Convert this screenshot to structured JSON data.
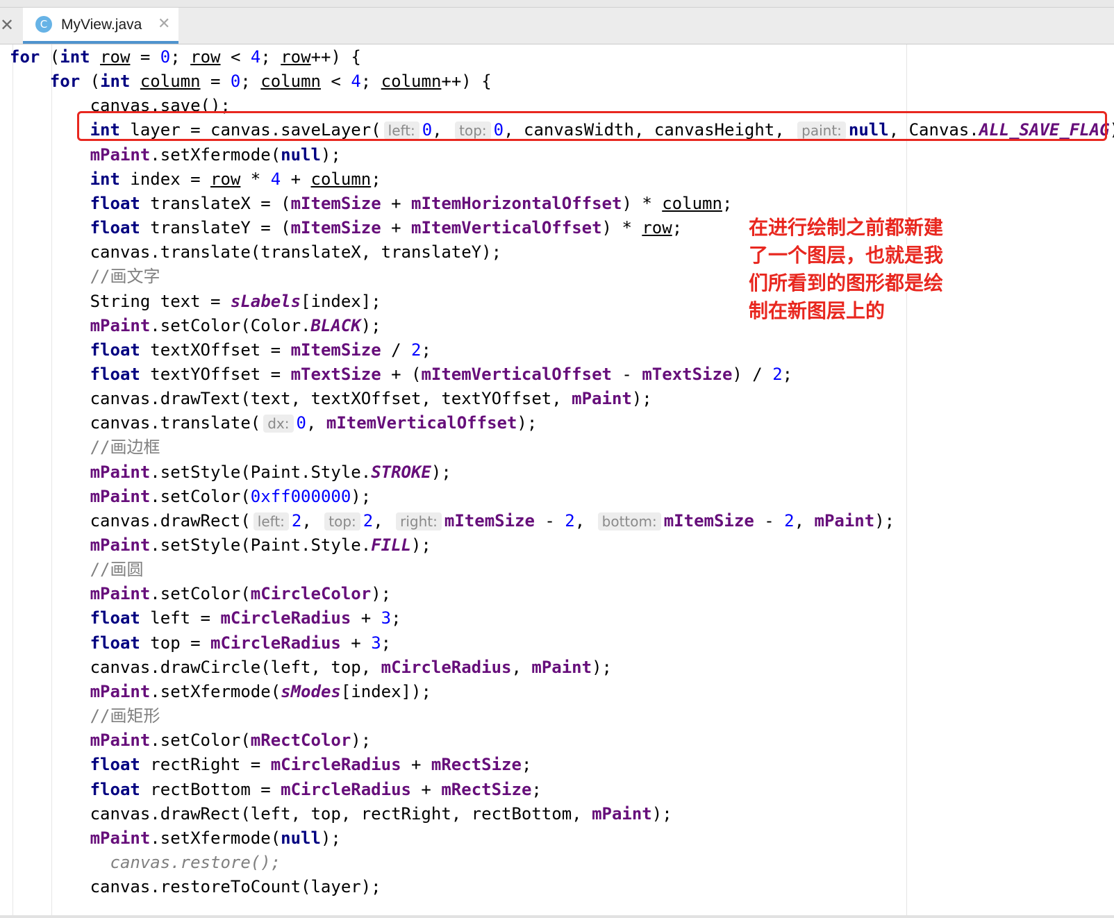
{
  "editor_tab": {
    "icon_letter": "C",
    "filename": "MyView.java",
    "close_glyph": "✕"
  },
  "left_close_glyph": "✕",
  "annotation": [
    "在进行绘制之前都新建",
    "了一个图层，也就是我",
    "们所看到的图形都是绘",
    "制在新图层上的"
  ],
  "code_lines": [
    [
      [
        "kw",
        "for"
      ],
      [
        "t",
        " ("
      ],
      [
        "kw",
        "int "
      ],
      [
        "u",
        "row"
      ],
      [
        "t",
        " = "
      ],
      [
        "n",
        "0"
      ],
      [
        "t",
        "; "
      ],
      [
        "u",
        "row"
      ],
      [
        "t",
        " < "
      ],
      [
        "n",
        "4"
      ],
      [
        "t",
        "; "
      ],
      [
        "u",
        "row"
      ],
      [
        "t",
        "++) {"
      ]
    ],
    [
      [
        "t",
        "    "
      ],
      [
        "kw",
        "for"
      ],
      [
        "t",
        " ("
      ],
      [
        "kw",
        "int "
      ],
      [
        "u",
        "column"
      ],
      [
        "t",
        " = "
      ],
      [
        "n",
        "0"
      ],
      [
        "t",
        "; "
      ],
      [
        "u",
        "column"
      ],
      [
        "t",
        " < "
      ],
      [
        "n",
        "4"
      ],
      [
        "t",
        "; "
      ],
      [
        "u",
        "column"
      ],
      [
        "t",
        "++) {"
      ]
    ],
    [
      [
        "t",
        "        canvas.save();"
      ]
    ],
    [
      [
        "t",
        "        "
      ],
      [
        "kw",
        "int"
      ],
      [
        "t",
        " layer = canvas.saveLayer("
      ],
      [
        "h",
        "left:"
      ],
      [
        "n",
        "0"
      ],
      [
        "t",
        ", "
      ],
      [
        "h",
        "top:"
      ],
      [
        "n",
        "0"
      ],
      [
        "t",
        ", canvasWidth, canvasHeight, "
      ],
      [
        "h",
        "paint:"
      ],
      [
        "kw",
        "null"
      ],
      [
        "t",
        ", Canvas."
      ],
      [
        "s",
        "ALL_SAVE_FLAG"
      ],
      [
        "t",
        ");"
      ]
    ],
    [
      [
        "t",
        "        "
      ],
      [
        "f",
        "mPaint"
      ],
      [
        "t",
        ".setXfermode("
      ],
      [
        "kw",
        "null"
      ],
      [
        "t",
        ");"
      ]
    ],
    [
      [
        "t",
        "        "
      ],
      [
        "kw",
        "int"
      ],
      [
        "t",
        " index = "
      ],
      [
        "u",
        "row"
      ],
      [
        "t",
        " * "
      ],
      [
        "n",
        "4"
      ],
      [
        "t",
        " + "
      ],
      [
        "u",
        "column"
      ],
      [
        "t",
        ";"
      ]
    ],
    [
      [
        "t",
        "        "
      ],
      [
        "kw",
        "float"
      ],
      [
        "t",
        " translateX = ("
      ],
      [
        "f",
        "mItemSize"
      ],
      [
        "t",
        " + "
      ],
      [
        "f",
        "mItemHorizontalOffset"
      ],
      [
        "t",
        ") * "
      ],
      [
        "u",
        "column"
      ],
      [
        "t",
        ";"
      ]
    ],
    [
      [
        "t",
        "        "
      ],
      [
        "kw",
        "float"
      ],
      [
        "t",
        " translateY = ("
      ],
      [
        "f",
        "mItemSize"
      ],
      [
        "t",
        " + "
      ],
      [
        "f",
        "mItemVerticalOffset"
      ],
      [
        "t",
        ") * "
      ],
      [
        "u",
        "row"
      ],
      [
        "t",
        ";"
      ]
    ],
    [
      [
        "t",
        "        canvas.translate(translateX, translateY);"
      ]
    ],
    [
      [
        "t",
        "        "
      ],
      [
        "c",
        "//画文字"
      ]
    ],
    [
      [
        "t",
        "        String text = "
      ],
      [
        "s",
        "sLabels"
      ],
      [
        "t",
        "[index];"
      ]
    ],
    [
      [
        "t",
        "        "
      ],
      [
        "f",
        "mPaint"
      ],
      [
        "t",
        ".setColor(Color."
      ],
      [
        "s",
        "BLACK"
      ],
      [
        "t",
        ");"
      ]
    ],
    [
      [
        "t",
        "        "
      ],
      [
        "kw",
        "float"
      ],
      [
        "t",
        " textXOffset = "
      ],
      [
        "f",
        "mItemSize"
      ],
      [
        "t",
        " / "
      ],
      [
        "n",
        "2"
      ],
      [
        "t",
        ";"
      ]
    ],
    [
      [
        "t",
        "        "
      ],
      [
        "kw",
        "float"
      ],
      [
        "t",
        " textYOffset = "
      ],
      [
        "f",
        "mTextSize"
      ],
      [
        "t",
        " + ("
      ],
      [
        "f",
        "mItemVerticalOffset"
      ],
      [
        "t",
        " - "
      ],
      [
        "f",
        "mTextSize"
      ],
      [
        "t",
        ") / "
      ],
      [
        "n",
        "2"
      ],
      [
        "t",
        ";"
      ]
    ],
    [
      [
        "t",
        "        canvas.drawText(text, textXOffset, textYOffset, "
      ],
      [
        "f",
        "mPaint"
      ],
      [
        "t",
        ");"
      ]
    ],
    [
      [
        "t",
        "        canvas.translate("
      ],
      [
        "h",
        "dx:"
      ],
      [
        "n",
        "0"
      ],
      [
        "t",
        ", "
      ],
      [
        "f",
        "mItemVerticalOffset"
      ],
      [
        "t",
        ");"
      ]
    ],
    [
      [
        "t",
        "        "
      ],
      [
        "c",
        "//画边框"
      ]
    ],
    [
      [
        "t",
        "        "
      ],
      [
        "f",
        "mPaint"
      ],
      [
        "t",
        ".setStyle(Paint.Style."
      ],
      [
        "s",
        "STROKE"
      ],
      [
        "t",
        ");"
      ]
    ],
    [
      [
        "t",
        "        "
      ],
      [
        "f",
        "mPaint"
      ],
      [
        "t",
        ".setColor("
      ],
      [
        "n",
        "0xff000000"
      ],
      [
        "t",
        ");"
      ]
    ],
    [
      [
        "t",
        "        canvas.drawRect("
      ],
      [
        "h",
        "left:"
      ],
      [
        "n",
        "2"
      ],
      [
        "t",
        ", "
      ],
      [
        "h",
        "top:"
      ],
      [
        "n",
        "2"
      ],
      [
        "t",
        ", "
      ],
      [
        "h",
        "right:"
      ],
      [
        "f",
        "mItemSize"
      ],
      [
        "t",
        " - "
      ],
      [
        "n",
        "2"
      ],
      [
        "t",
        ", "
      ],
      [
        "h",
        "bottom:"
      ],
      [
        "f",
        "mItemSize"
      ],
      [
        "t",
        " - "
      ],
      [
        "n",
        "2"
      ],
      [
        "t",
        ", "
      ],
      [
        "f",
        "mPaint"
      ],
      [
        "t",
        ");"
      ]
    ],
    [
      [
        "t",
        "        "
      ],
      [
        "f",
        "mPaint"
      ],
      [
        "t",
        ".setStyle(Paint.Style."
      ],
      [
        "s",
        "FILL"
      ],
      [
        "t",
        ");"
      ]
    ],
    [
      [
        "t",
        "        "
      ],
      [
        "c",
        "//画圆"
      ]
    ],
    [
      [
        "t",
        "        "
      ],
      [
        "f",
        "mPaint"
      ],
      [
        "t",
        ".setColor("
      ],
      [
        "f",
        "mCircleColor"
      ],
      [
        "t",
        ");"
      ]
    ],
    [
      [
        "t",
        "        "
      ],
      [
        "kw",
        "float"
      ],
      [
        "t",
        " left = "
      ],
      [
        "f",
        "mCircleRadius"
      ],
      [
        "t",
        " + "
      ],
      [
        "n",
        "3"
      ],
      [
        "t",
        ";"
      ]
    ],
    [
      [
        "t",
        "        "
      ],
      [
        "kw",
        "float"
      ],
      [
        "t",
        " top = "
      ],
      [
        "f",
        "mCircleRadius"
      ],
      [
        "t",
        " + "
      ],
      [
        "n",
        "3"
      ],
      [
        "t",
        ";"
      ]
    ],
    [
      [
        "t",
        "        canvas.drawCircle(left, top, "
      ],
      [
        "f",
        "mCircleRadius"
      ],
      [
        "t",
        ", "
      ],
      [
        "f",
        "mPaint"
      ],
      [
        "t",
        ");"
      ]
    ],
    [
      [
        "t",
        "        "
      ],
      [
        "f",
        "mPaint"
      ],
      [
        "t",
        ".setXfermode("
      ],
      [
        "s",
        "sModes"
      ],
      [
        "t",
        "[index]);"
      ]
    ],
    [
      [
        "t",
        "        "
      ],
      [
        "c",
        "//画矩形"
      ]
    ],
    [
      [
        "t",
        "        "
      ],
      [
        "f",
        "mPaint"
      ],
      [
        "t",
        ".setColor("
      ],
      [
        "f",
        "mRectColor"
      ],
      [
        "t",
        ");"
      ]
    ],
    [
      [
        "t",
        "        "
      ],
      [
        "kw",
        "float"
      ],
      [
        "t",
        " rectRight = "
      ],
      [
        "f",
        "mCircleRadius"
      ],
      [
        "t",
        " + "
      ],
      [
        "f",
        "mRectSize"
      ],
      [
        "t",
        ";"
      ]
    ],
    [
      [
        "t",
        "        "
      ],
      [
        "kw",
        "float"
      ],
      [
        "t",
        " rectBottom = "
      ],
      [
        "f",
        "mCircleRadius"
      ],
      [
        "t",
        " + "
      ],
      [
        "f",
        "mRectSize"
      ],
      [
        "t",
        ";"
      ]
    ],
    [
      [
        "t",
        "        canvas.drawRect(left, top, rectRight, rectBottom, "
      ],
      [
        "f",
        "mPaint"
      ],
      [
        "t",
        ");"
      ]
    ],
    [
      [
        "t",
        "        "
      ],
      [
        "f",
        "mPaint"
      ],
      [
        "t",
        ".setXfermode("
      ],
      [
        "kw",
        "null"
      ],
      [
        "t",
        ");"
      ]
    ],
    [
      [
        "t",
        "          "
      ],
      [
        "d",
        "canvas.restore();"
      ]
    ],
    [
      [
        "t",
        "        canvas.restoreToCount(layer);"
      ]
    ]
  ]
}
